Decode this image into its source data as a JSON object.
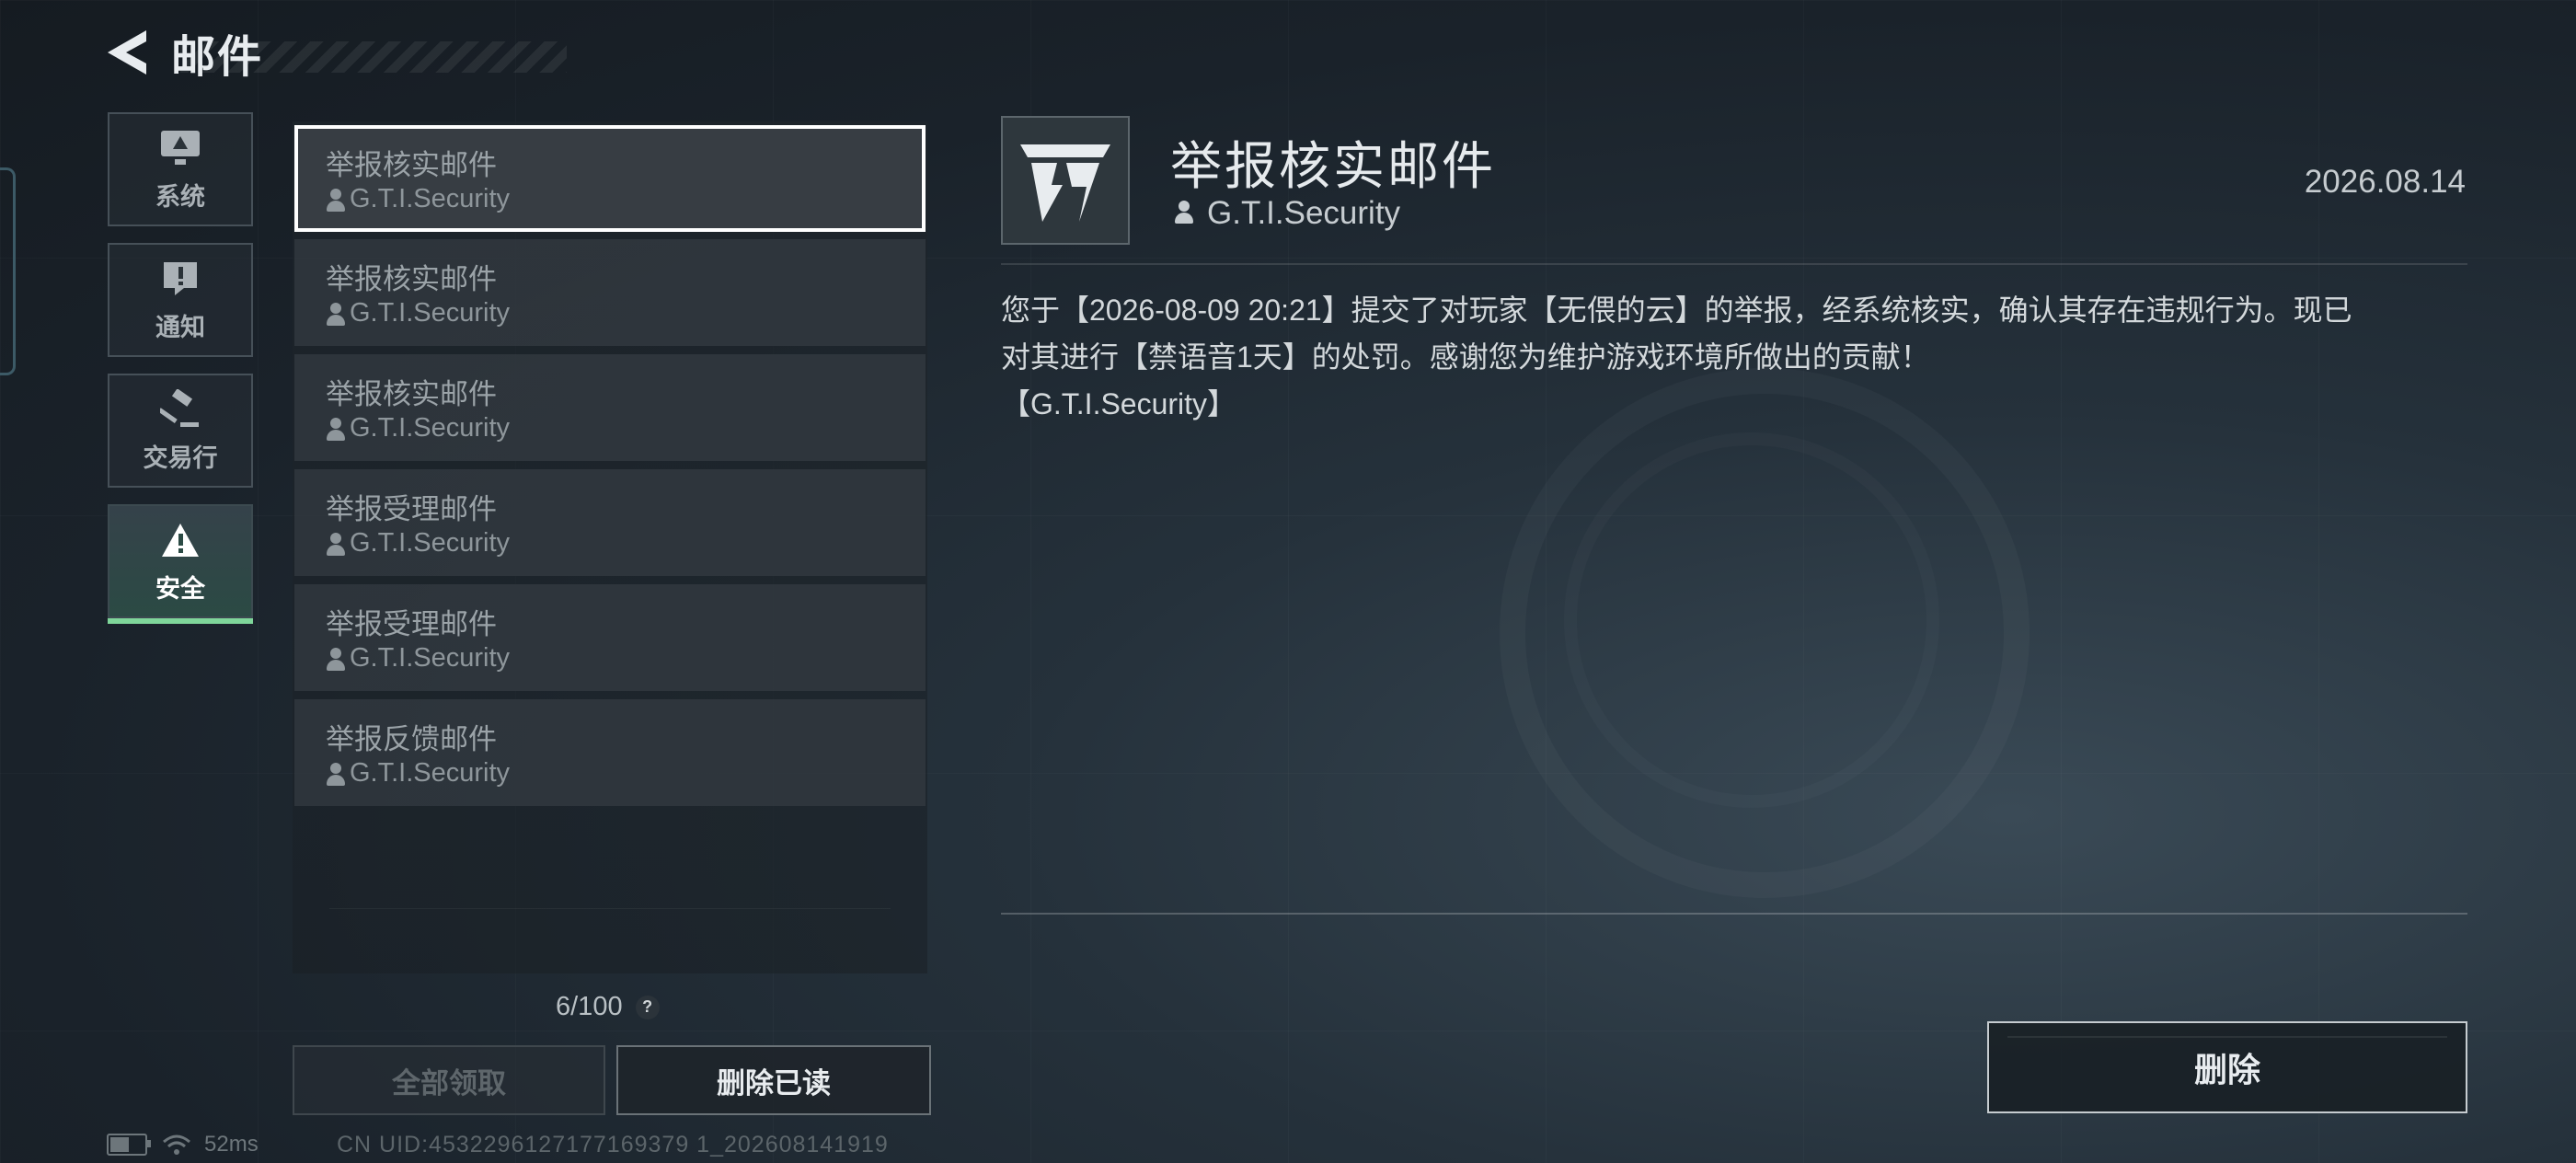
{
  "header": {
    "title": "邮件",
    "back_icon": "back-arrow-icon"
  },
  "categories": [
    {
      "label": "系统",
      "icon": "monitor-icon",
      "active": false
    },
    {
      "label": "通知",
      "icon": "exclamation-icon",
      "active": false
    },
    {
      "label": "交易行",
      "icon": "gavel-icon",
      "active": false
    },
    {
      "label": "安全",
      "icon": "warning-triangle-icon",
      "active": true
    }
  ],
  "mail_list": [
    {
      "title": "举报核实邮件",
      "sender": "G.T.I.Security",
      "selected": true
    },
    {
      "title": "举报核实邮件",
      "sender": "G.T.I.Security",
      "selected": false
    },
    {
      "title": "举报核实邮件",
      "sender": "G.T.I.Security",
      "selected": false
    },
    {
      "title": "举报受理邮件",
      "sender": "G.T.I.Security",
      "selected": false
    },
    {
      "title": "举报受理邮件",
      "sender": "G.T.I.Security",
      "selected": false
    },
    {
      "title": "举报反馈邮件",
      "sender": "G.T.I.Security",
      "selected": false
    }
  ],
  "mail_count": {
    "text": "6/100",
    "help_label": "?"
  },
  "buttons": {
    "collect_all": "全部领取",
    "delete_read": "删除已读",
    "delete": "删除"
  },
  "status_bar": {
    "ping": "52ms",
    "battery_level": 0.6,
    "uid": "CN UID:4532296127177169379 1_202608141919"
  },
  "detail": {
    "icon": "gti-logo-icon",
    "title": "举报核实邮件",
    "sender": "G.T.I.Security",
    "date": "2026.08.14",
    "body_line1": "您于【2026-08-09 20:21】提交了对玩家【无偎的云】的举报，经系统核实，确认其存在违规行为。现已",
    "body_line2": "对其进行【禁语音1天】的处罚。感谢您为维护游戏环境所做出的贡献！",
    "body_line3": "【G.T.I.Security】"
  },
  "colors": {
    "accent_green": "#7fd69a",
    "selected_border": "#ffffff"
  }
}
